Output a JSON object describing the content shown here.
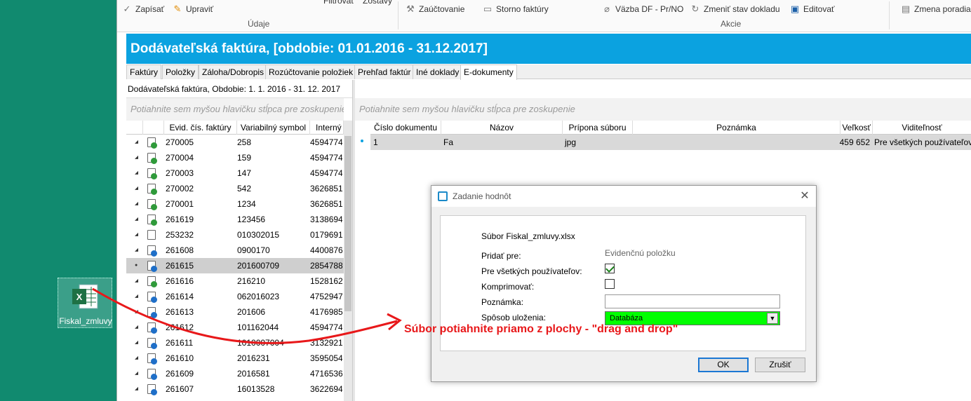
{
  "desktop": {
    "icon_label": "Fiskal_zmluvy"
  },
  "ribbon": {
    "udaje": {
      "save": "Zapísať",
      "edit": "Upraviť",
      "group": "Údaje"
    },
    "filter": "Filtrovať",
    "reports": "Zostavy",
    "akcie": {
      "post": "Zaúčtovanie",
      "storno": "Storno faktúry",
      "link": "Väzba DF - Pr/NO",
      "change_state": "Zmeniť stav dokladu",
      "editovat": "Editovať",
      "group": "Akcie"
    },
    "order": "Zmena poradia"
  },
  "title": "Dodávateľská faktúra, [obdobie: 01.01.2016 - 31.12.2017]",
  "tabs": [
    {
      "label": "Faktúry"
    },
    {
      "label": "Položky"
    },
    {
      "label": "Záloha/Dobropis"
    },
    {
      "label": "Rozúčtovanie položiek"
    },
    {
      "label": "Prehľad faktúr"
    },
    {
      "label": "Iné doklady"
    },
    {
      "label": "E-dokumenty"
    }
  ],
  "left": {
    "header": "Dodávateľská faktúra, Obdobie: 1. 1. 2016 - 31. 12. 2017",
    "group_hint": "Potiahnite sem myšou hlavičku stĺpca pre zoskupenie",
    "columns": [
      "Evid. čís. faktúry",
      "Variabilný symbol",
      "Interný"
    ],
    "rows": [
      {
        "evid": "270005",
        "vs": "258",
        "int": "4594774"
      },
      {
        "evid": "270004",
        "vs": "159",
        "int": "4594774"
      },
      {
        "evid": "270003",
        "vs": "147",
        "int": "4594774"
      },
      {
        "evid": "270002",
        "vs": "542",
        "int": "3626851"
      },
      {
        "evid": "270001",
        "vs": "1234",
        "int": "3626851"
      },
      {
        "evid": "261619",
        "vs": "123456",
        "int": "3138694"
      },
      {
        "evid": "253232",
        "vs": "010302015",
        "int": "0179691"
      },
      {
        "evid": "261608",
        "vs": "0900170",
        "int": "4400876"
      },
      {
        "evid": "261615",
        "vs": "201600709",
        "int": "2854788"
      },
      {
        "evid": "261616",
        "vs": "216210",
        "int": "1528162"
      },
      {
        "evid": "261614",
        "vs": "062016023",
        "int": "4752947"
      },
      {
        "evid": "261613",
        "vs": "201606",
        "int": "4176985"
      },
      {
        "evid": "261612",
        "vs": "101162044",
        "int": "4594774"
      },
      {
        "evid": "261611",
        "vs": "1010007004",
        "int": "3132921"
      },
      {
        "evid": "261610",
        "vs": "2016231",
        "int": "3595054"
      },
      {
        "evid": "261609",
        "vs": "2016581",
        "int": "4716536"
      },
      {
        "evid": "261607",
        "vs": "16013528",
        "int": "3622694"
      }
    ]
  },
  "right": {
    "group_hint": "Potiahnite sem myšou hlavičku stĺpca pre zoskupenie",
    "columns": [
      "Číslo dokumentu",
      "Názov",
      "Prípona súboru",
      "Poznámka",
      "Veľkosť",
      "Viditeľnosť"
    ],
    "row": {
      "cislo": "1",
      "nazov": "Fa",
      "pripona": "jpg",
      "poznamka": "",
      "velkost": "459 652",
      "viditelnost": "Pre všetkých používateľov"
    }
  },
  "dialog": {
    "title": "Zadanie hodnôt",
    "file_label": "Súbor Fiskal_zmluvy.xlsx",
    "add_for_label": "Pridať pre:",
    "add_for_value": "Evidenčnú položku",
    "all_users_label": "Pre všetkých používateľov:",
    "all_users_checked": true,
    "compress_label": "Komprimovať:",
    "compress_checked": false,
    "note_label": "Poznámka:",
    "note_value": "",
    "storage_label": "Spôsob uloženia:",
    "storage_value": "Databáza",
    "ok": "OK",
    "cancel": "Zrušiť"
  },
  "annotation": "Súbor potiahnite priamo z plochy - \"drag and drop\"",
  "colors": {
    "title_bar": "#0ba2e0",
    "desktop": "#118a6f",
    "annotation": "#e8181a",
    "storage_highlight": "#00ff00"
  }
}
